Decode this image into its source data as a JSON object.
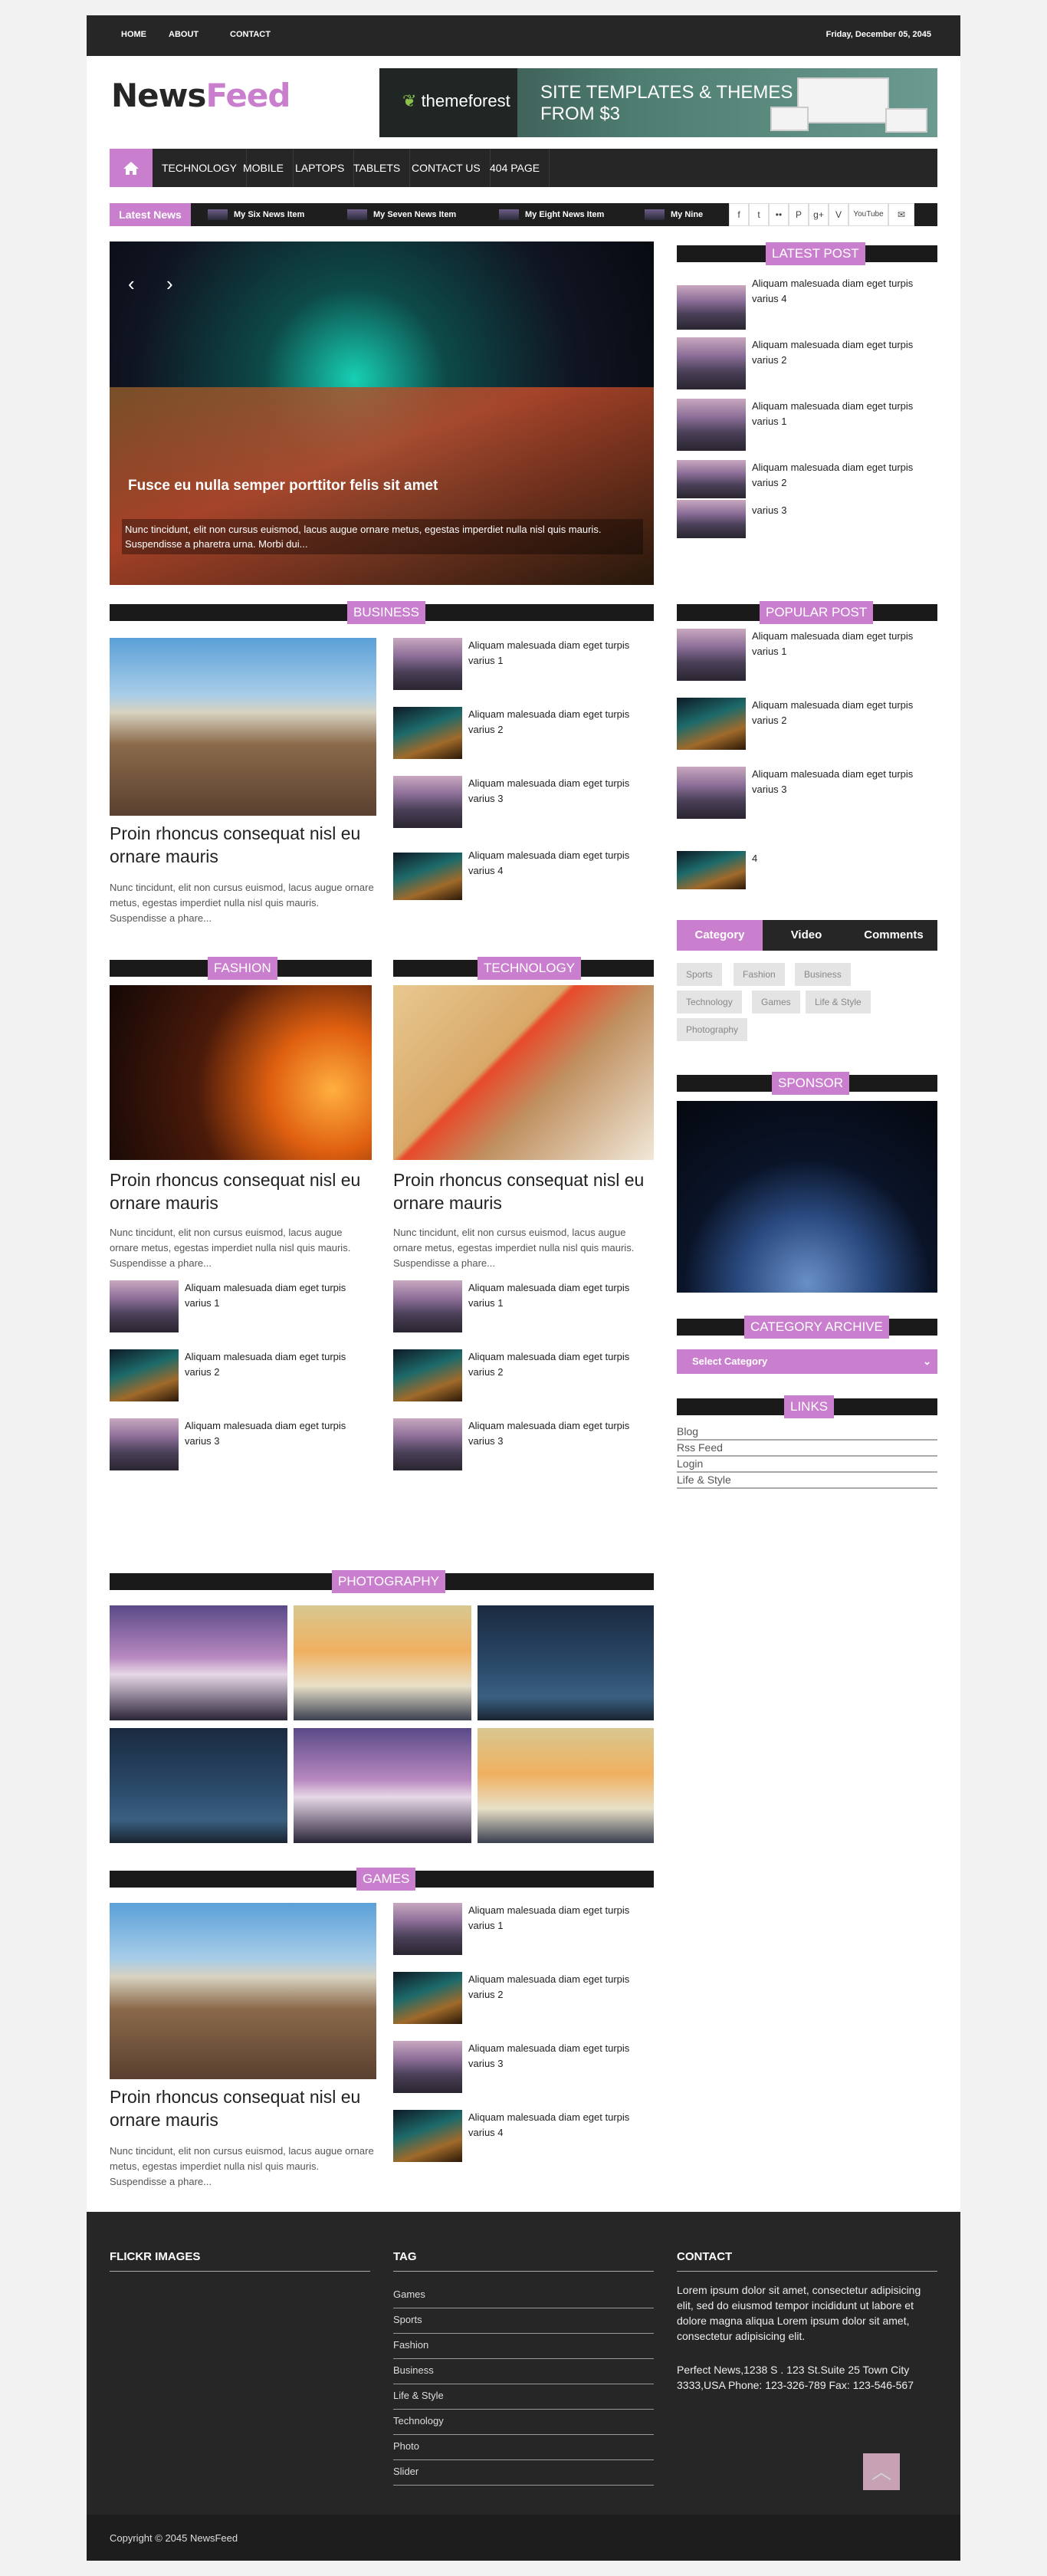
{
  "topbar": {
    "links": [
      "HOME",
      "ABOUT",
      "CONTACT"
    ],
    "date": "Friday, December 05, 2045"
  },
  "logo": {
    "part1": "News",
    "part2": "Feed"
  },
  "banner": {
    "brand": "themeforest",
    "line1": "SITE TEMPLATES & THEMES",
    "line2": "FROM $3"
  },
  "nav": {
    "items": [
      "TECHNOLOGY",
      "MOBILE",
      "LAPTOPS",
      "TABLETS",
      "CONTACT US",
      "404 PAGE"
    ]
  },
  "ticker": {
    "label": "Latest News",
    "items": [
      "My Six News Item",
      "My Seven News Item",
      "My Eight News Item",
      "My Nine New"
    ]
  },
  "social": {
    "icons": [
      "facebook-icon",
      "twitter-icon",
      "flickr-icon",
      "pinterest-icon",
      "googleplus-icon",
      "vimeo-icon",
      "youtube-icon",
      "email-icon"
    ],
    "glyphs": [
      "f",
      "t",
      "••",
      "P",
      "g+",
      "V",
      "YouTube",
      "✉"
    ]
  },
  "slider": {
    "prev": "‹",
    "next": "›",
    "caption": "Fusce eu nulla semper porttitor felis sit amet",
    "description": "Nunc tincidunt, elit non cursus euismod, lacus augue ornare metus, egestas imperdiet nulla nisl quis mauris. Suspendisse a pharetra urna. Morbi dui..."
  },
  "business": {
    "heading": "BUSINESS",
    "title": "Proin rhoncus consequat nisl eu ornare mauris",
    "excerpt": "Nunc tincidunt, elit non cursus euismod, lacus augue ornare metus, egestas imperdiet nulla nisl quis mauris. Suspendisse a phare...",
    "list": [
      "Aliquam malesuada diam eget turpis varius 1",
      "Aliquam malesuada diam eget turpis varius 2",
      "Aliquam malesuada diam eget turpis varius 3",
      "Aliquam malesuada diam eget turpis varius 4"
    ]
  },
  "fashion": {
    "heading": "FASHION",
    "title": "Proin rhoncus consequat nisl eu ornare mauris",
    "excerpt": "Nunc tincidunt, elit non cursus euismod, lacus augue ornare metus, egestas imperdiet nulla nisl quis mauris. Suspendisse a phare...",
    "list": [
      "Aliquam malesuada diam eget turpis varius 1",
      "Aliquam malesuada diam eget turpis varius 2",
      "Aliquam malesuada diam eget turpis varius 3"
    ]
  },
  "technology": {
    "heading": "TECHNOLOGY",
    "title": "Proin rhoncus consequat nisl eu ornare mauris",
    "excerpt": "Nunc tincidunt, elit non cursus euismod, lacus augue ornare metus, egestas imperdiet nulla nisl quis mauris. Suspendisse a phare...",
    "list": [
      "Aliquam malesuada diam eget turpis varius 1",
      "Aliquam malesuada diam eget turpis varius 2",
      "Aliquam malesuada diam eget turpis varius 3"
    ]
  },
  "photography": {
    "heading": "PHOTOGRAPHY"
  },
  "games": {
    "heading": "GAMES",
    "title": "Proin rhoncus consequat nisl eu ornare mauris",
    "excerpt": "Nunc tincidunt, elit non cursus euismod, lacus augue ornare metus, egestas imperdiet nulla nisl quis mauris. Suspendisse a phare...",
    "list": [
      "Aliquam malesuada diam eget turpis varius 1",
      "Aliquam malesuada diam eget turpis varius 2",
      "Aliquam malesuada diam eget turpis varius 3",
      "Aliquam malesuada diam eget turpis varius 4"
    ]
  },
  "sidebar": {
    "latest_heading": "LATEST POST",
    "latest": [
      "Aliquam malesuada diam eget turpis varius 4",
      "Aliquam malesuada diam eget turpis varius 2",
      "Aliquam malesuada diam eget turpis varius 1",
      "Aliquam malesuada diam eget turpis varius 2",
      "varius 3"
    ],
    "popular_heading": "POPULAR POST",
    "popular": [
      "Aliquam malesuada diam eget turpis varius 1",
      "Aliquam malesuada diam eget turpis varius 2",
      "Aliquam malesuada diam eget turpis varius 3",
      "4"
    ],
    "tabs": [
      "Category",
      "Video",
      "Comments"
    ],
    "tags": [
      "Sports",
      "Fashion",
      "Business",
      "Technology",
      "Games",
      "Life & Style",
      "Photography"
    ],
    "sponsor_heading": "SPONSOR",
    "archive_heading": "CATEGORY ARCHIVE",
    "select_value": "Select Category",
    "links_heading": "LINKS",
    "links": [
      "Blog",
      "Rss Feed",
      "Login",
      "Life & Style"
    ]
  },
  "footer": {
    "flickr_heading": "FLICKR IMAGES",
    "tag_heading": "TAG",
    "tags": [
      "Games",
      "Sports",
      "Fashion",
      "Business",
      "Life & Style",
      "Technology",
      "Photo",
      "Slider"
    ],
    "contact_heading": "CONTACT",
    "contact_text": "Lorem ipsum dolor sit amet, consectetur adipisicing elit, sed do eiusmod tempor incididunt ut labore et dolore magna aliqua Lorem ipsum dolor sit amet, consectetur adipisicing elit.",
    "address": "Perfect News,1238 S . 123 St.Suite 25 Town City 3333,USA Phone: 123-326-789 Fax: 123-546-567",
    "copyright": "Copyright © 2045 NewsFeed",
    "to_top": "︿"
  },
  "colors": {
    "accent": "#c97fcd",
    "dark": "#262626"
  }
}
